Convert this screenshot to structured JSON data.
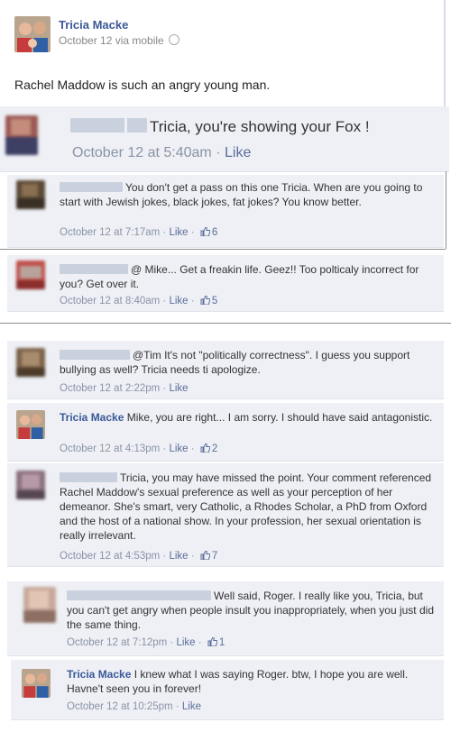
{
  "post": {
    "author": "Tricia Macke",
    "meta": "October 12 via mobile",
    "status": "Rachel Maddow is such an angry young man."
  },
  "comments": [
    {
      "name": "",
      "text": "Tricia, you're showing your Fox !",
      "time": "October 12 at 5:40am",
      "like": "Like",
      "likes": ""
    },
    {
      "name": "",
      "text": "You don't get a pass on this one Tricia. When are you going to start with Jewish jokes, black jokes, fat jokes? You know better.",
      "time": "October 12 at 7:17am",
      "like": "Like",
      "likes": "6"
    },
    {
      "name": "",
      "text": "@ Mike... Get a freakin life. Geez!! Too polticaly incorrect for you? Get over it.",
      "time": "October 12 at 8:40am",
      "like": "Like",
      "likes": "5"
    },
    {
      "name": "",
      "text": "@Tim It's not \"politically correctness\". I guess you support bullying as well? Tricia needs ti apologize.",
      "time": "October 12 at 2:22pm",
      "like": "Like",
      "likes": ""
    },
    {
      "name": "Tricia Macke",
      "text": "Mike, you are right... I am sorry. I should have said antagonistic.",
      "time": "October 12 at 4:13pm",
      "like": "Like",
      "likes": "2"
    },
    {
      "name": "",
      "text": "Tricia, you may have missed the point. Your comment referenced Rachel Maddow's sexual preference as well as your perception of her demeanor. She's smart, very Catholic, a Rhodes Scholar, a PhD from Oxford and the host of a national show. In your profession, her sexual orientation is really irrelevant.",
      "time": "October 12 at 4:53pm",
      "like": "Like",
      "likes": "7"
    },
    {
      "name": "",
      "text": "Well said, Roger. I really like you, Tricia, but you can't get angry when people insult you inappropriately, when you just did the same thing.",
      "time": "October 12 at 7:12pm",
      "like": "Like",
      "likes": "1"
    },
    {
      "name": "Tricia Macke",
      "text": "I knew what I was saying Roger. btw, I hope you are well. Havne't seen you in forever!",
      "time": "October 12 at 10:25pm",
      "like": "Like",
      "likes": ""
    }
  ],
  "colors": {
    "link": "#3b5998",
    "comment_bg": "#eef0f5",
    "meta": "#8b93a6"
  }
}
